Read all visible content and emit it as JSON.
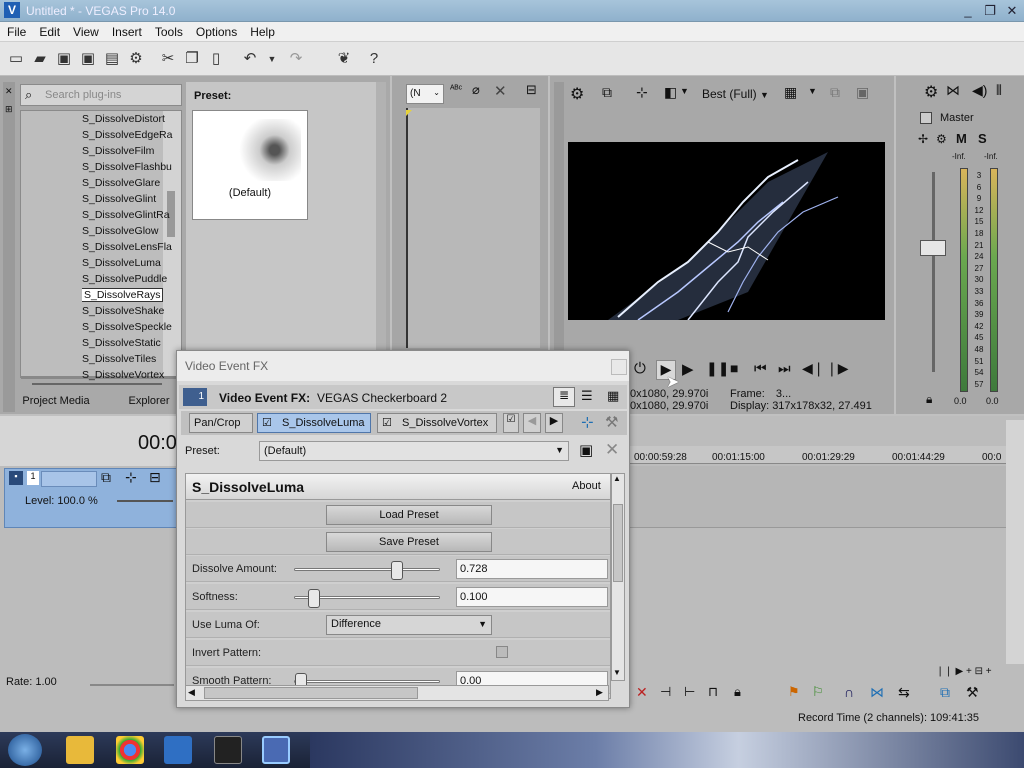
{
  "window": {
    "title": "Untitled * - VEGAS Pro 14.0",
    "minimize": "_",
    "restore": "❐",
    "close": "✕"
  },
  "menu": [
    "File",
    "Edit",
    "View",
    "Insert",
    "Tools",
    "Options",
    "Help"
  ],
  "explorer": {
    "search_placeholder": "Search plug-ins",
    "items": [
      "S_DissolveDistort",
      "S_DissolveEdgeRa",
      "S_DissolveFilm",
      "S_DissolveFlashbu",
      "S_DissolveGlare",
      "S_DissolveGlint",
      "S_DissolveGlintRa",
      "S_DissolveGlow",
      "S_DissolveLensFla",
      "S_DissolveLuma",
      "S_DissolvePuddle",
      "S_DissolveRays",
      "S_DissolveShake",
      "S_DissolveSpeckle",
      "S_DissolveStatic",
      "S_DissolveTiles",
      "S_DissolveVortex"
    ],
    "selected": "S_DissolveRays",
    "preset_label": "Preset:",
    "preset_name": "(Default)",
    "tabs": [
      "Project Media",
      "Explorer"
    ]
  },
  "trimmer": {
    "combo": "(N"
  },
  "preview": {
    "quality": "Best (Full)",
    "project": "0x1080, 29.970i",
    "preview": "0x1080, 29.970i",
    "frame_label": "Frame:",
    "frame_value": "3...",
    "display_label": "Display:",
    "display_value": "317x178x32, 27.491"
  },
  "mixer": {
    "master": "Master",
    "m": "M",
    "s": "S",
    "inf_left": "-Inf.",
    "inf_right": "-Inf.",
    "scale": [
      "3",
      "6",
      "9",
      "12",
      "15",
      "18",
      "21",
      "24",
      "27",
      "30",
      "33",
      "36",
      "39",
      "42",
      "45",
      "48",
      "51",
      "54",
      "57"
    ],
    "bottom_left": "0.0",
    "bottom_right": "0.0"
  },
  "timeline": {
    "time": "00:0",
    "level": "Level: 100.0 %",
    "track_no": "1",
    "ruler": [
      "00:00:59:28",
      "00:01:15:00",
      "00:01:29:29",
      "00:01:44:29",
      "00:0"
    ],
    "rate": "Rate: 1.00",
    "record_time": "Record Time (2 channels): 109:41:35"
  },
  "dialog": {
    "title": "Video Event FX",
    "header_label": "Video Event FX:",
    "header_value": "VEGAS Checkerboard 2",
    "track_no": "1",
    "chain": [
      "Pan/Crop",
      "S_DissolveLuma",
      "S_DissolveVortex"
    ],
    "preset_label": "Preset:",
    "preset_value": "(Default)",
    "plugin_name": "S_DissolveLuma",
    "about": "About",
    "load_preset": "Load Preset",
    "save_preset": "Save Preset",
    "params": [
      {
        "label": "Dissolve Amount:",
        "value": "0.728",
        "slider": 0.728
      },
      {
        "label": "Softness:",
        "value": "0.100",
        "slider": 0.1
      },
      {
        "label": "Use Luma Of:",
        "value": "Difference"
      },
      {
        "label": "Invert Pattern:"
      },
      {
        "label": "Smooth Pattern:",
        "value": "0.00",
        "slider": 0.0
      }
    ]
  }
}
